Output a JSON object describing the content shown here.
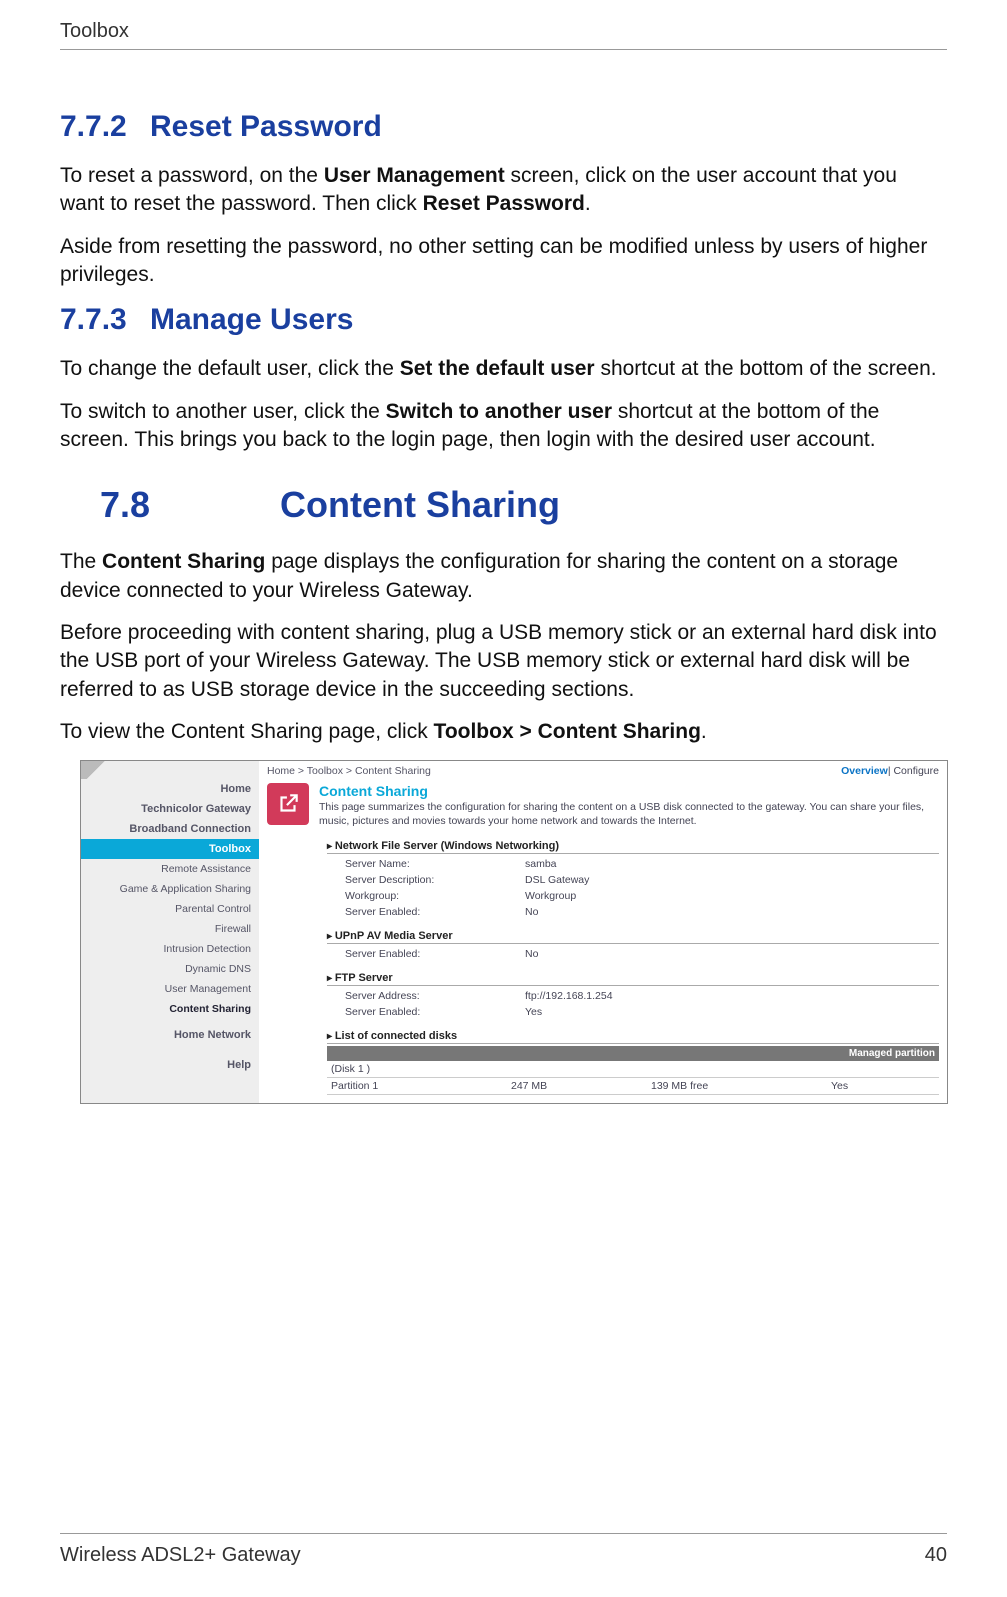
{
  "header": {
    "section": "Toolbox"
  },
  "sections": {
    "s772": {
      "num": "7.7.2",
      "title": "Reset Password",
      "p1a": "To reset a password, on the ",
      "p1b": "User Management",
      "p1c": " screen, click on the user account that you want to reset the password. Then click ",
      "p1d": "Reset Password",
      "p1e": ".",
      "p2": "Aside from resetting the password, no other setting can be modified unless by users of higher privileges."
    },
    "s773": {
      "num": "7.7.3",
      "title": "Manage Users",
      "p1a": "To change the default user, click the ",
      "p1b": "Set the default user",
      "p1c": " shortcut at the bottom of the screen.",
      "p2a": "To switch to another user, click the ",
      "p2b": "Switch to another user",
      "p2c": " shortcut at the bottom of the screen. This brings you back to the login page, then login with the desired user account."
    },
    "s78": {
      "num": "7.8",
      "title": "Content Sharing",
      "p1a": "The ",
      "p1b": "Content Sharing",
      "p1c": " page displays the configuration for sharing the content on a storage device connected to your Wireless Gateway.",
      "p2": "Before proceeding with content sharing, plug a USB memory stick or an external hard disk into the USB port of your Wireless Gateway. The USB memory stick or external hard disk will be referred to as USB storage device in the succeeding sections.",
      "p3a": "To view the Content Sharing page, click ",
      "p3b": "Toolbox > Content Sharing",
      "p3c": "."
    }
  },
  "screenshot": {
    "breadcrumb": "Home > Toolbox > Content Sharing",
    "overview": "Overview",
    "configure": " | Configure",
    "sidebar": {
      "home": "Home",
      "tech": "Technicolor Gateway",
      "bb": "Broadband Connection",
      "toolbox": "Toolbox",
      "items": [
        "Remote Assistance",
        "Game & Application Sharing",
        "Parental Control",
        "Firewall",
        "Intrusion Detection",
        "Dynamic DNS",
        "User Management",
        "Content Sharing"
      ],
      "homenet": "Home Network",
      "help": "Help"
    },
    "title": "Content Sharing",
    "desc": "This page summarizes the configuration for sharing the content on a USB disk connected to the gateway. You can share your files, music, pictures and movies towards your home network and towards the Internet.",
    "nfs": {
      "heading": "Network File Server (Windows Networking)",
      "rows": [
        {
          "k": "Server Name:",
          "v": "samba"
        },
        {
          "k": "Server Description:",
          "v": "DSL Gateway"
        },
        {
          "k": "Workgroup:",
          "v": "Workgroup"
        },
        {
          "k": "Server Enabled:",
          "v": "No"
        }
      ]
    },
    "upnp": {
      "heading": "UPnP AV Media Server",
      "rows": [
        {
          "k": "Server Enabled:",
          "v": "No"
        }
      ]
    },
    "ftp": {
      "heading": "FTP Server",
      "rows": [
        {
          "k": "Server Address:",
          "v": "ftp://192.168.1.254"
        },
        {
          "k": "Server Enabled:",
          "v": "Yes"
        }
      ]
    },
    "disks": {
      "heading": "List of connected disks",
      "col_managed": "Managed partition",
      "group": "(Disk 1 )",
      "row": {
        "name": "Partition 1",
        "size": "247 MB",
        "free": "139 MB free",
        "managed": "Yes"
      }
    }
  },
  "footer": {
    "product": "Wireless ADSL2+ Gateway",
    "page": "40"
  }
}
